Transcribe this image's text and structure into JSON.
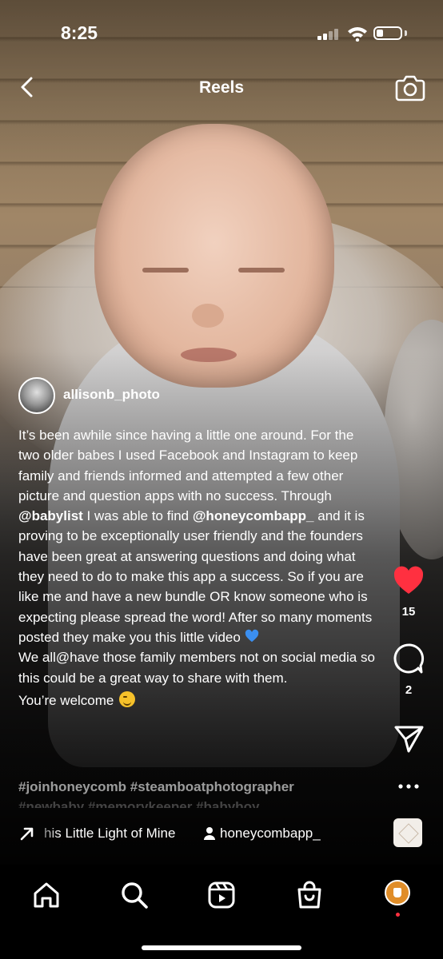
{
  "status_bar": {
    "time": "8:25",
    "battery_level": 0.3
  },
  "header": {
    "title": "Reels"
  },
  "author": {
    "username": "allisonb_photo"
  },
  "caption": {
    "p1_a": "It’s been awhile since having a little one around. For the two older babes I used Facebook and Instagram to keep family and friends informed and attempted a few other picture and question apps with no success. Through ",
    "mention1": "@babylist",
    "p1_b": " I was able to find ",
    "mention2": "@honeycombapp_",
    "p1_c": " and it is proving to be exceptionally user friendly and the founders have been great at answering questions and doing what they need to do to make this app a success. So if you are like me and have a new bundle OR know someone who is expecting please spread the word! After so many moments posted they make you this little video ",
    "p2": "We all@have those family members not on social media so this could be a great way to share with them.",
    "p3": "You’re welcome ",
    "hashtags_line1": "#joinhoneycomb #steamboatphotographer",
    "hashtags_line2": "#newbaby #memorykeeper #babyboy"
  },
  "actions": {
    "likes": "15",
    "comments": "2"
  },
  "audio": {
    "song": "his Little Light of Mine",
    "tagged_user": "honeycombapp_"
  },
  "colors": {
    "like": "#ff3040",
    "profile": "#e08d28"
  }
}
